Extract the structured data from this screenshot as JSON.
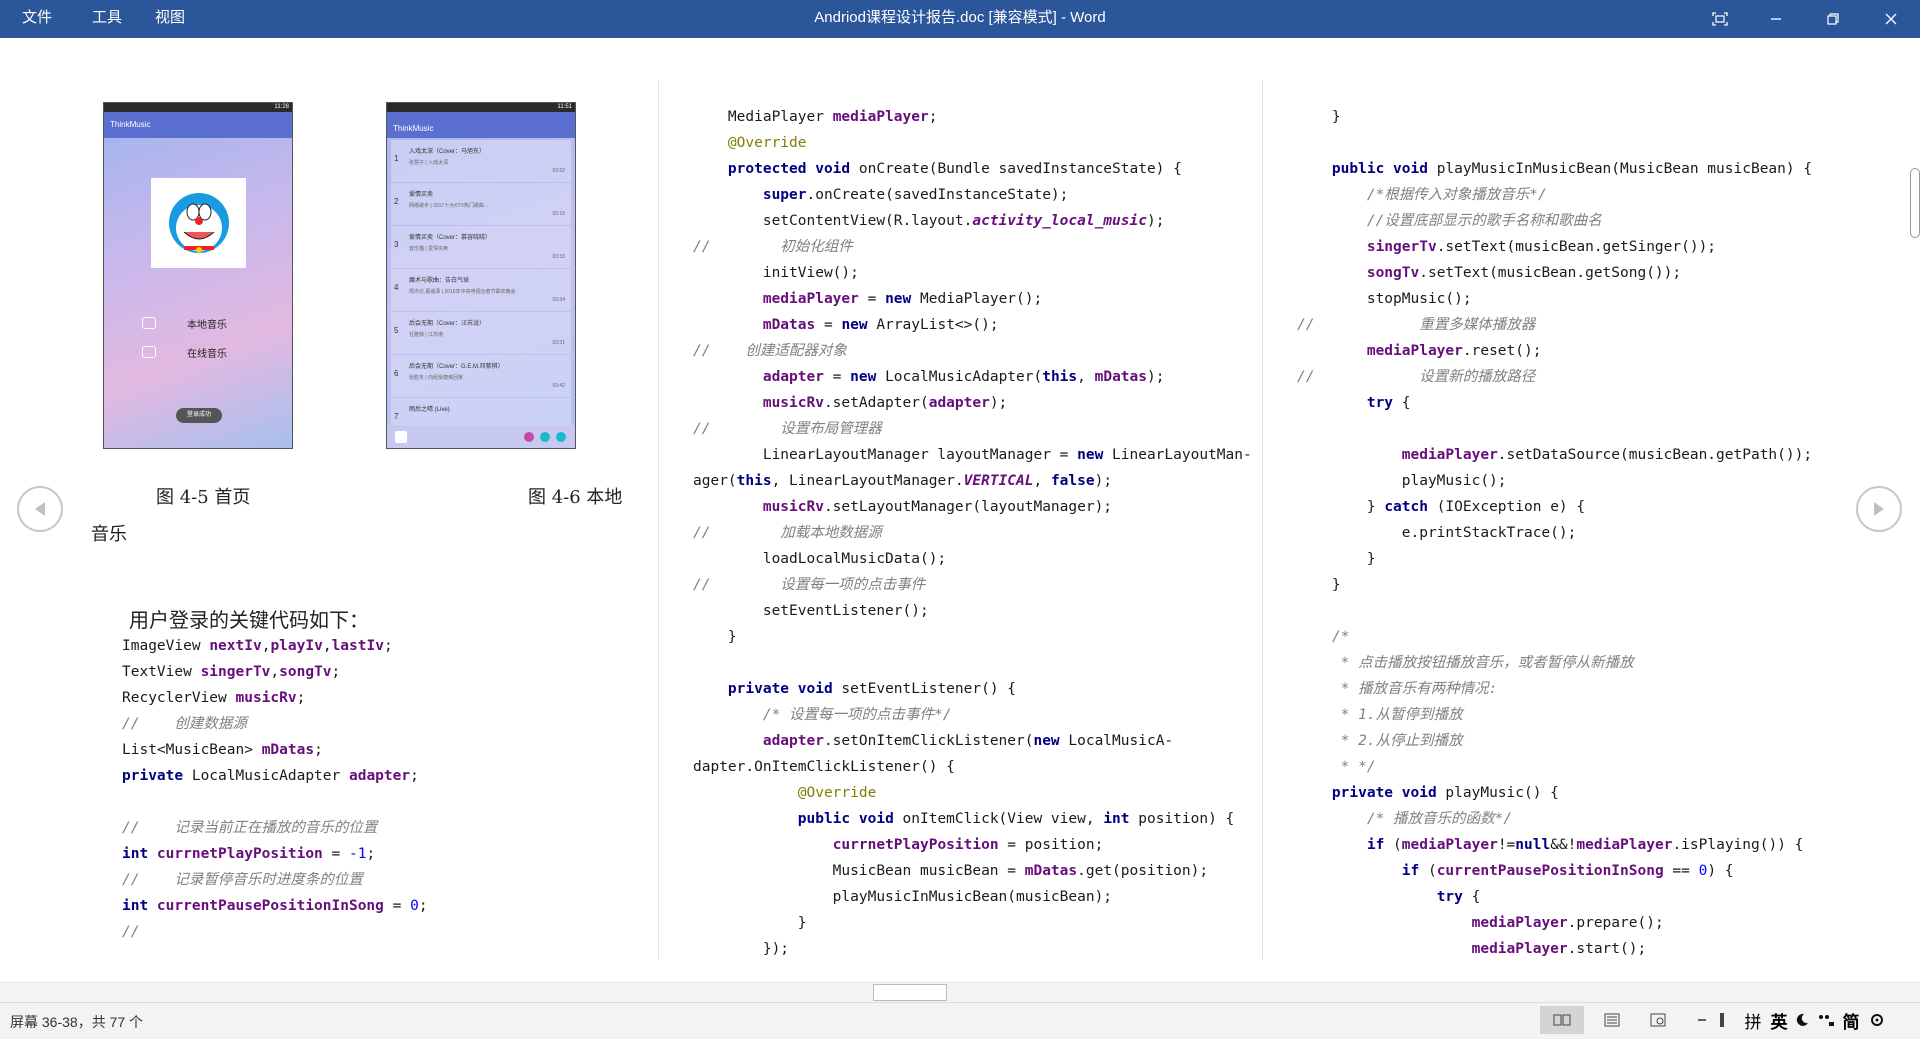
{
  "window": {
    "menu": [
      "文件",
      "工具",
      "视图"
    ],
    "title": "Andriod课程设计报告.doc [兼容模式]  -  Word"
  },
  "left": {
    "phone1": {
      "status": "11:28",
      "app_title": "ThinkMusic",
      "menu_local": "本地音乐",
      "menu_online": "在线音乐",
      "login_btn": "登录成功"
    },
    "phone2": {
      "status": "11:51",
      "app_title": "ThinkMusic",
      "songs": [
        {
          "no": "1",
          "title": "入戏太深（Cover：马旭东）",
          "sub": "张慧子  |  入戏太深",
          "time": "03:52"
        },
        {
          "no": "2",
          "title": "爱情买卖",
          "sub": "网络歌手  |  2017十大KTV热门歌曲…",
          "time": "03:16"
        },
        {
          "no": "3",
          "title": "爱情买卖（Cover：慕容晓晓）",
          "sub": "音乐猫  |  爱情买卖",
          "time": "03:33"
        },
        {
          "no": "4",
          "title": "魔术与歌曲：告白气球",
          "sub": "周杰伦,蔡威泽  |  2016年中央电视台春节联欢晚会",
          "time": "03:34"
        },
        {
          "no": "5",
          "title": "后会无期（Cover：汪苏泷）",
          "sub": "任雅婧  |  江苏南",
          "time": "03:31"
        },
        {
          "no": "6",
          "title": "后会无期（Cover：G.E.M.邓紫棋）",
          "sub": "张胜冬  |  向经受磨炼回家",
          "time": "03:42"
        },
        {
          "no": "7",
          "title": "雨后之晴 (Live)",
          "sub": "",
          "time": ""
        }
      ]
    },
    "caption1": "图 4-5  首页",
    "caption2": "图 4-6 本地",
    "caption2_cont": "音乐",
    "heading": "用户登录的关键代码如下：",
    "code": [
      [
        {
          "t": "ImageView "
        },
        {
          "t": "nextIv",
          "c": "fld"
        },
        {
          "t": ","
        },
        {
          "t": "playIv",
          "c": "fld"
        },
        {
          "t": ","
        },
        {
          "t": "lastIv",
          "c": "fld"
        },
        {
          "t": ";"
        }
      ],
      [
        {
          "t": "TextView "
        },
        {
          "t": "singerTv",
          "c": "fld"
        },
        {
          "t": ","
        },
        {
          "t": "songTv",
          "c": "fld"
        },
        {
          "t": ";"
        }
      ],
      [
        {
          "t": "RecyclerView "
        },
        {
          "t": "musicRv",
          "c": "fld"
        },
        {
          "t": ";"
        }
      ],
      [
        {
          "t": "//    创建数据源",
          "c": "cm"
        }
      ],
      [
        {
          "t": "List<MusicBean> "
        },
        {
          "t": "mDatas",
          "c": "fld"
        },
        {
          "t": ";"
        }
      ],
      [
        {
          "t": "private ",
          "c": "kw"
        },
        {
          "t": "LocalMusicAdapter "
        },
        {
          "t": "adapter",
          "c": "fld"
        },
        {
          "t": ";"
        }
      ],
      [],
      [
        {
          "t": "//    记录当前正在播放的音乐的位置",
          "c": "cm"
        }
      ],
      [
        {
          "t": "int ",
          "c": "kw"
        },
        {
          "t": "currnetPlayPosition",
          "c": "fld"
        },
        {
          "t": " = "
        },
        {
          "t": "-1",
          "c": "num"
        },
        {
          "t": ";"
        }
      ],
      [
        {
          "t": "//    记录暂停音乐时进度条的位置",
          "c": "cm"
        }
      ],
      [
        {
          "t": "int ",
          "c": "kw"
        },
        {
          "t": "currentPausePositionInSong",
          "c": "fld"
        },
        {
          "t": " = "
        },
        {
          "t": "0",
          "c": "num"
        },
        {
          "t": ";"
        }
      ],
      [
        {
          "t": "//",
          "c": "cm"
        }
      ]
    ]
  },
  "middle": {
    "code": [
      [
        {
          "t": "    MediaPlayer "
        },
        {
          "t": "mediaPlayer",
          "c": "fld"
        },
        {
          "t": ";"
        }
      ],
      [
        {
          "t": "    "
        },
        {
          "t": "@Override",
          "c": "ann"
        }
      ],
      [
        {
          "t": "    "
        },
        {
          "t": "protected void ",
          "c": "kw"
        },
        {
          "t": "onCreate(Bundle savedInstanceState) {"
        }
      ],
      [
        {
          "t": "        "
        },
        {
          "t": "super",
          "c": "kw"
        },
        {
          "t": ".onCreate(savedInstanceState);"
        }
      ],
      [
        {
          "t": "        setContentView(R.layout."
        },
        {
          "t": "activity_local_music",
          "c": "fld ital"
        },
        {
          "t": ");"
        }
      ],
      [
        {
          "t": "//        初始化组件",
          "c": "cm"
        }
      ],
      [
        {
          "t": "        initView();"
        }
      ],
      [
        {
          "t": "        "
        },
        {
          "t": "mediaPlayer",
          "c": "fld"
        },
        {
          "t": " = "
        },
        {
          "t": "new ",
          "c": "kw"
        },
        {
          "t": "MediaPlayer();"
        }
      ],
      [
        {
          "t": "        "
        },
        {
          "t": "mDatas",
          "c": "fld"
        },
        {
          "t": " = "
        },
        {
          "t": "new ",
          "c": "kw"
        },
        {
          "t": "ArrayList<>();"
        }
      ],
      [
        {
          "t": "//    创建适配器对象",
          "c": "cm"
        }
      ],
      [
        {
          "t": "        "
        },
        {
          "t": "adapter",
          "c": "fld"
        },
        {
          "t": " = "
        },
        {
          "t": "new ",
          "c": "kw"
        },
        {
          "t": "LocalMusicAdapter("
        },
        {
          "t": "this",
          "c": "kw"
        },
        {
          "t": ", "
        },
        {
          "t": "mDatas",
          "c": "fld"
        },
        {
          "t": ");"
        }
      ],
      [
        {
          "t": "        "
        },
        {
          "t": "musicRv",
          "c": "fld"
        },
        {
          "t": ".setAdapter("
        },
        {
          "t": "adapter",
          "c": "fld"
        },
        {
          "t": ");"
        }
      ],
      [
        {
          "t": "//        设置布局管理器",
          "c": "cm"
        }
      ],
      [
        {
          "t": "        LinearLayoutManager layoutManager = "
        },
        {
          "t": "new ",
          "c": "kw"
        },
        {
          "t": "LinearLayoutMan-"
        }
      ],
      [
        {
          "t": "ager("
        },
        {
          "t": "this",
          "c": "kw"
        },
        {
          "t": ", LinearLayoutManager."
        },
        {
          "t": "VERTICAL",
          "c": "fld ital"
        },
        {
          "t": ", "
        },
        {
          "t": "false",
          "c": "kw"
        },
        {
          "t": ");"
        }
      ],
      [
        {
          "t": "        "
        },
        {
          "t": "musicRv",
          "c": "fld"
        },
        {
          "t": ".setLayoutManager(layoutManager);"
        }
      ],
      [
        {
          "t": "//        加载本地数据源",
          "c": "cm"
        }
      ],
      [
        {
          "t": "        loadLocalMusicData();"
        }
      ],
      [
        {
          "t": "//        设置每一项的点击事件",
          "c": "cm"
        }
      ],
      [
        {
          "t": "        setEventListener();"
        }
      ],
      [
        {
          "t": "    }"
        }
      ],
      [],
      [
        {
          "t": "    "
        },
        {
          "t": "private void ",
          "c": "kw"
        },
        {
          "t": "setEventListener() {"
        }
      ],
      [
        {
          "t": "        "
        },
        {
          "t": "/* 设置每一项的点击事件*/",
          "c": "cm"
        }
      ],
      [
        {
          "t": "        "
        },
        {
          "t": "adapter",
          "c": "fld"
        },
        {
          "t": ".setOnItemClickListener("
        },
        {
          "t": "new ",
          "c": "kw"
        },
        {
          "t": "LocalMusicA-"
        }
      ],
      [
        {
          "t": "dapter.OnItemClickListener() {"
        }
      ],
      [
        {
          "t": "            "
        },
        {
          "t": "@Override",
          "c": "ann"
        }
      ],
      [
        {
          "t": "            "
        },
        {
          "t": "public void ",
          "c": "kw"
        },
        {
          "t": "onItemClick(View view, "
        },
        {
          "t": "int ",
          "c": "kw"
        },
        {
          "t": "position) {"
        }
      ],
      [
        {
          "t": "                "
        },
        {
          "t": "currnetPlayPosition",
          "c": "fld"
        },
        {
          "t": " = position;"
        }
      ],
      [
        {
          "t": "                MusicBean musicBean = "
        },
        {
          "t": "mDatas",
          "c": "fld"
        },
        {
          "t": ".get(position);"
        }
      ],
      [
        {
          "t": "                playMusicInMusicBean(musicBean);"
        }
      ],
      [
        {
          "t": "            }"
        }
      ],
      [
        {
          "t": "        });"
        }
      ]
    ]
  },
  "right": {
    "code": [
      [
        {
          "t": "    }"
        }
      ],
      [],
      [
        {
          "t": "    "
        },
        {
          "t": "public void ",
          "c": "kw"
        },
        {
          "t": "playMusicInMusicBean(MusicBean musicBean) {"
        }
      ],
      [
        {
          "t": "        "
        },
        {
          "t": "/*根据传入对象播放音乐*/",
          "c": "cm"
        }
      ],
      [
        {
          "t": "        "
        },
        {
          "t": "//设置底部显示的歌手名称和歌曲名",
          "c": "cm"
        }
      ],
      [
        {
          "t": "        "
        },
        {
          "t": "singerTv",
          "c": "fld"
        },
        {
          "t": ".setText(musicBean.getSinger());"
        }
      ],
      [
        {
          "t": "        "
        },
        {
          "t": "songTv",
          "c": "fld"
        },
        {
          "t": ".setText(musicBean.getSong());"
        }
      ],
      [
        {
          "t": "        stopMusic();"
        }
      ],
      [
        {
          "t": "//            重置多媒体播放器",
          "c": "cm"
        }
      ],
      [
        {
          "t": "        "
        },
        {
          "t": "mediaPlayer",
          "c": "fld"
        },
        {
          "t": ".reset();"
        }
      ],
      [
        {
          "t": "//            设置新的播放路径",
          "c": "cm"
        }
      ],
      [
        {
          "t": "        "
        },
        {
          "t": "try ",
          "c": "kw"
        },
        {
          "t": "{"
        }
      ],
      [],
      [
        {
          "t": "            "
        },
        {
          "t": "mediaPlayer",
          "c": "fld"
        },
        {
          "t": ".setDataSource(musicBean.getPath());"
        }
      ],
      [
        {
          "t": "            playMusic();"
        }
      ],
      [
        {
          "t": "        } "
        },
        {
          "t": "catch ",
          "c": "kw"
        },
        {
          "t": "(IOException e) {"
        }
      ],
      [
        {
          "t": "            e.printStackTrace();"
        }
      ],
      [
        {
          "t": "        }"
        }
      ],
      [
        {
          "t": "    }"
        }
      ],
      [],
      [
        {
          "t": "    "
        },
        {
          "t": "/*",
          "c": "cm"
        }
      ],
      [
        {
          "t": "     "
        },
        {
          "t": "* 点击播放按钮播放音乐，或者暂停从新播放",
          "c": "cm"
        }
      ],
      [
        {
          "t": "     "
        },
        {
          "t": "* 播放音乐有两种情况:",
          "c": "cm"
        }
      ],
      [
        {
          "t": "     "
        },
        {
          "t": "* 1.从暂停到播放",
          "c": "cm"
        }
      ],
      [
        {
          "t": "     "
        },
        {
          "t": "* 2.从停止到播放",
          "c": "cm"
        }
      ],
      [
        {
          "t": "     "
        },
        {
          "t": "* */",
          "c": "cm"
        }
      ],
      [
        {
          "t": "    "
        },
        {
          "t": "private void ",
          "c": "kw"
        },
        {
          "t": "playMusic() {"
        }
      ],
      [
        {
          "t": "        "
        },
        {
          "t": "/* 播放音乐的函数*/",
          "c": "cm"
        }
      ],
      [
        {
          "t": "        "
        },
        {
          "t": "if ",
          "c": "kw"
        },
        {
          "t": "("
        },
        {
          "t": "mediaPlayer",
          "c": "fld"
        },
        {
          "t": "!="
        },
        {
          "t": "null",
          "c": "kw"
        },
        {
          "t": "&&!"
        },
        {
          "t": "mediaPlayer",
          "c": "fld"
        },
        {
          "t": ".isPlaying()) {"
        }
      ],
      [
        {
          "t": "            "
        },
        {
          "t": "if ",
          "c": "kw"
        },
        {
          "t": "("
        },
        {
          "t": "currentPausePositionInSong",
          "c": "fld"
        },
        {
          "t": " == "
        },
        {
          "t": "0",
          "c": "num"
        },
        {
          "t": ") {"
        }
      ],
      [
        {
          "t": "                "
        },
        {
          "t": "try ",
          "c": "kw"
        },
        {
          "t": "{"
        }
      ],
      [
        {
          "t": "                    "
        },
        {
          "t": "mediaPlayer",
          "c": "fld"
        },
        {
          "t": ".prepare();"
        }
      ],
      [
        {
          "t": "                    "
        },
        {
          "t": "mediaPlayer",
          "c": "fld"
        },
        {
          "t": ".start();"
        }
      ]
    ]
  },
  "status": {
    "page_info": "屏幕 36-38，共 77 个",
    "ime": [
      "拼",
      "英",
      "简"
    ]
  }
}
